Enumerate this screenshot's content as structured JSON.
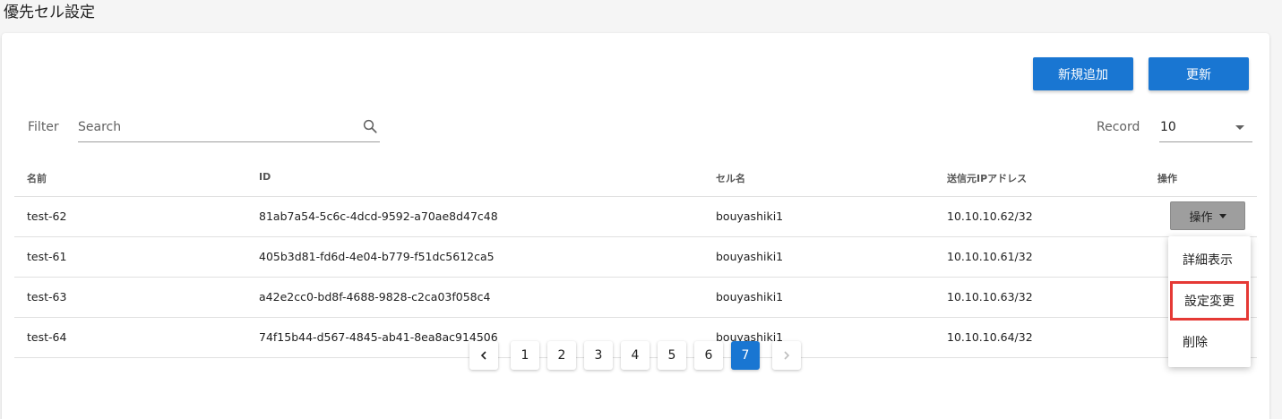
{
  "page": {
    "title": "優先セル設定"
  },
  "toolbar": {
    "add_label": "新規追加",
    "refresh_label": "更新"
  },
  "filter": {
    "label": "Filter",
    "placeholder": "Search",
    "icon": "search-icon"
  },
  "record": {
    "label": "Record",
    "value": "10"
  },
  "table": {
    "headers": [
      "名前",
      "ID",
      "セル名",
      "送信元IPアドレス",
      "操作"
    ],
    "rows": [
      {
        "name": "test-62",
        "id": "81ab7a54-5c6c-4dcd-9592-a70ae8d47c48",
        "cell": "bouyashiki1",
        "ip": "10.10.10.62/32"
      },
      {
        "name": "test-61",
        "id": "405b3d81-fd6d-4e04-b779-f51dc5612ca5",
        "cell": "bouyashiki1",
        "ip": "10.10.10.61/32"
      },
      {
        "name": "test-63",
        "id": "a42e2cc0-bd8f-4688-9828-c2ca03f058c4",
        "cell": "bouyashiki1",
        "ip": "10.10.10.63/32"
      },
      {
        "name": "test-64",
        "id": "74f15b44-d567-4845-ab41-8ea8ac914506",
        "cell": "bouyashiki1",
        "ip": "10.10.10.64/32"
      }
    ],
    "op_button_label": "操作"
  },
  "menu": {
    "items": [
      "詳細表示",
      "設定変更",
      "削除"
    ],
    "highlighted": "設定変更"
  },
  "pagination": {
    "pages": [
      "1",
      "2",
      "3",
      "4",
      "5",
      "6",
      "7"
    ],
    "current": "7",
    "prev_icon": "chevron-left-icon",
    "next_icon": "chevron-right-icon"
  },
  "colors": {
    "primary": "#1976d2",
    "highlight": "#e53935",
    "op_button": "#9e9e9e"
  }
}
